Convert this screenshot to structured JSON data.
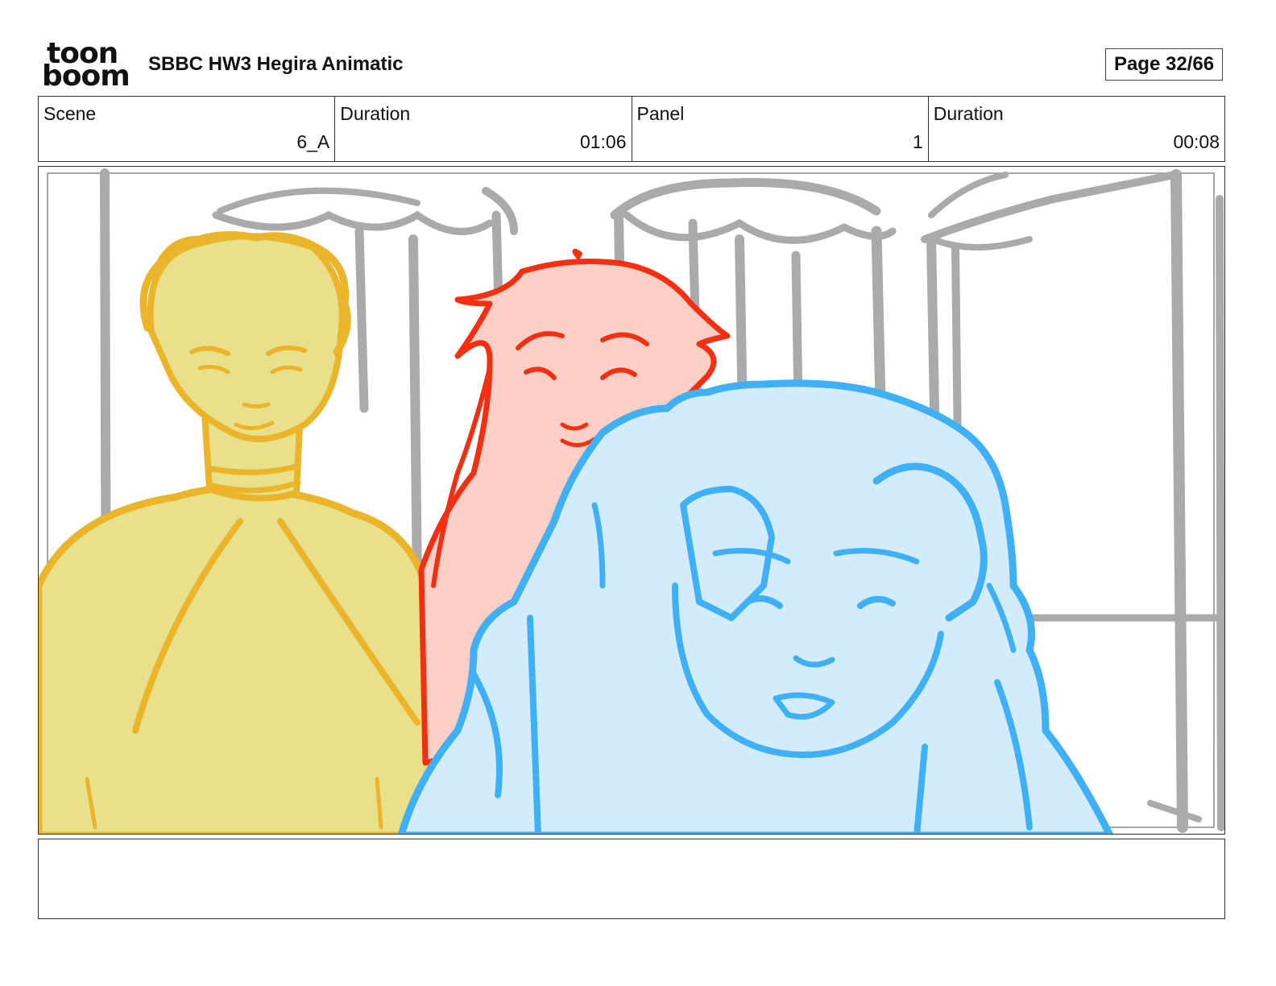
{
  "header": {
    "logo_line1": "toon",
    "logo_line2": "boom",
    "logo_name": "toon-boom-logo",
    "title": "SBBC HW3 Hegira Animatic",
    "page": "Page 32/66"
  },
  "info": {
    "scene_label": "Scene",
    "scene_value": "6_A",
    "scene_duration_label": "Duration",
    "scene_duration_value": "01:06",
    "panel_label": "Panel",
    "panel_value": "1",
    "panel_duration_label": "Duration",
    "panel_duration_value": "00:08"
  },
  "panel": {
    "colors": {
      "background_sketch": "#aaaaaa",
      "yellow_fill": "#e8e08a",
      "yellow_line": "#eab52a",
      "red_fill": "#fcd0c6",
      "red_line": "#f52f12",
      "blue_fill": "#d3ecfb",
      "blue_line": "#3fb0f5"
    }
  },
  "caption": {
    "text": ""
  }
}
